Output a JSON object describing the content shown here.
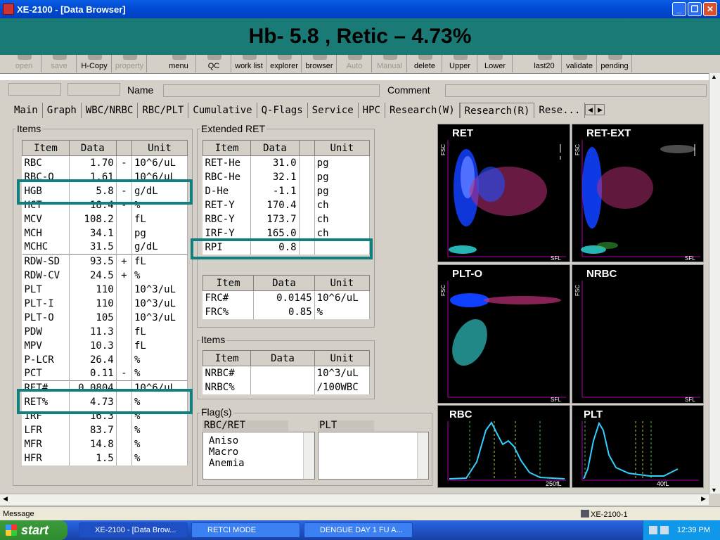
{
  "window": {
    "title": "XE-2100 - [Data Browser]"
  },
  "banner": {
    "text": "Hb- 5.8 , Retic – 4.73%"
  },
  "toolbar": [
    {
      "label": "open",
      "enabled": false
    },
    {
      "label": "save",
      "enabled": false
    },
    {
      "label": "H-Copy",
      "enabled": true
    },
    {
      "label": "property",
      "enabled": false
    },
    {
      "label": "menu",
      "enabled": true
    },
    {
      "label": "QC",
      "enabled": true
    },
    {
      "label": "work list",
      "enabled": true
    },
    {
      "label": "explorer",
      "enabled": true
    },
    {
      "label": "browser",
      "enabled": true
    },
    {
      "label": "Auto",
      "enabled": false
    },
    {
      "label": "Manual",
      "enabled": false
    },
    {
      "label": "delete",
      "enabled": true
    },
    {
      "label": "Upper",
      "enabled": true
    },
    {
      "label": "Lower",
      "enabled": true
    },
    {
      "label": "last20",
      "enabled": true
    },
    {
      "label": "validate",
      "enabled": true
    },
    {
      "label": "pending",
      "enabled": true
    }
  ],
  "header": {
    "name_label": "Name",
    "comment_label": "Comment"
  },
  "tabs": [
    "Main",
    "Graph",
    "WBC/NRBC",
    "RBC/PLT",
    "Cumulative",
    "Q-Flags",
    "Service",
    "HPC",
    "Research(W)",
    "Research(R)",
    "Rese..."
  ],
  "active_tab": "Research(R)",
  "items_group": {
    "title": "Items",
    "headers": [
      "Item",
      "Data",
      "",
      "Unit"
    ],
    "rows": [
      {
        "item": "RBC",
        "data": "1.70",
        "flag": "-",
        "unit": "10^6/uL"
      },
      {
        "item": "RBC-O",
        "data": "1.61",
        "flag": "",
        "unit": "10^6/uL"
      },
      {
        "item": "HGB",
        "data": "5.8",
        "flag": "-",
        "unit": "g/dL"
      },
      {
        "item": "HCT",
        "data": "18.4",
        "flag": "-",
        "unit": "%"
      },
      {
        "item": "MCV",
        "data": "108.2",
        "flag": "",
        "unit": "fL"
      },
      {
        "item": "MCH",
        "data": "34.1",
        "flag": "",
        "unit": "pg"
      },
      {
        "item": "MCHC",
        "data": "31.5",
        "flag": "",
        "unit": "g/dL"
      },
      {
        "item": "RDW-SD",
        "data": "93.5",
        "flag": "+",
        "unit": "fL"
      },
      {
        "item": "RDW-CV",
        "data": "24.5",
        "flag": "+",
        "unit": "%"
      },
      {
        "item": "PLT",
        "data": "110",
        "flag": "",
        "unit": "10^3/uL"
      },
      {
        "item": "PLT-I",
        "data": "110",
        "flag": "",
        "unit": "10^3/uL"
      },
      {
        "item": "PLT-O",
        "data": "105",
        "flag": "",
        "unit": "10^3/uL"
      },
      {
        "item": "PDW",
        "data": "11.3",
        "flag": "",
        "unit": "fL"
      },
      {
        "item": "MPV",
        "data": "10.3",
        "flag": "",
        "unit": "fL"
      },
      {
        "item": "P-LCR",
        "data": "26.4",
        "flag": "",
        "unit": "%"
      },
      {
        "item": "PCT",
        "data": "0.11",
        "flag": "-",
        "unit": "%"
      },
      {
        "item": "RET#",
        "data": "0.0804",
        "flag": "",
        "unit": "10^6/uL"
      },
      {
        "item": "RET%",
        "data": "4.73",
        "flag": "",
        "unit": "%"
      },
      {
        "item": "IRF",
        "data": "16.3",
        "flag": "",
        "unit": "%"
      },
      {
        "item": "LFR",
        "data": "83.7",
        "flag": "",
        "unit": "%"
      },
      {
        "item": "MFR",
        "data": "14.8",
        "flag": "",
        "unit": "%"
      },
      {
        "item": "HFR",
        "data": "1.5",
        "flag": "",
        "unit": "%"
      }
    ]
  },
  "extended_ret": {
    "title": "Extended RET",
    "headers": [
      "Item",
      "Data",
      "",
      "Unit"
    ],
    "rows": [
      {
        "item": "RET-He",
        "data": "31.0",
        "unit": "pg"
      },
      {
        "item": "RBC-He",
        "data": "32.1",
        "unit": "pg"
      },
      {
        "item": "D-He",
        "data": "-1.1",
        "unit": "pg"
      },
      {
        "item": "RET-Y",
        "data": "170.4",
        "unit": "ch"
      },
      {
        "item": "RBC-Y",
        "data": "173.7",
        "unit": "ch"
      },
      {
        "item": "IRF-Y",
        "data": "165.0",
        "unit": "ch"
      },
      {
        "item": "RPI",
        "data": "0.8",
        "unit": ""
      }
    ],
    "frc_headers": [
      "Item",
      "Data",
      "Unit"
    ],
    "frc_rows": [
      {
        "item": "FRC#",
        "data": "0.0145",
        "unit": "10^6/uL"
      },
      {
        "item": "FRC%",
        "data": "0.85",
        "unit": "%"
      }
    ]
  },
  "items2": {
    "title": "Items",
    "headers": [
      "Item",
      "Data",
      "Unit"
    ],
    "rows": [
      {
        "item": "NRBC#",
        "data": "",
        "unit": "10^3/uL"
      },
      {
        "item": "NRBC%",
        "data": "",
        "unit": "/100WBC"
      }
    ]
  },
  "flags": {
    "title": "Flag(s)",
    "rbc_ret_label": "RBC/RET",
    "plt_label": "PLT",
    "rbc_ret": [
      "Aniso",
      "Macro",
      "Anemia"
    ],
    "plt": []
  },
  "scattergrams": {
    "ret": "RET",
    "ret_ext": "RET-EXT",
    "plt_o": "PLT-O",
    "nrbc": "NRBC",
    "rbc": "RBC",
    "plt": "PLT",
    "fsc": "FSC",
    "sfl": "SFL",
    "rbc_axis": "250fL",
    "plt_axis": "40fL"
  },
  "status": {
    "message": "Message",
    "instrument": "XE-2100-1"
  },
  "taskbar": {
    "start": "start",
    "tasks": [
      "XE-2100 - [Data Brow...",
      "RETCI MODE",
      "DENGUE DAY 1 FU A..."
    ],
    "clock": "12:39 PM"
  },
  "colors": {
    "banner": "#1a7a76",
    "highlight": "#0f7f80",
    "scatter_blue": "#1040ff",
    "scatter_magenta": "#c0307a",
    "histogram": "#30d0ff"
  }
}
